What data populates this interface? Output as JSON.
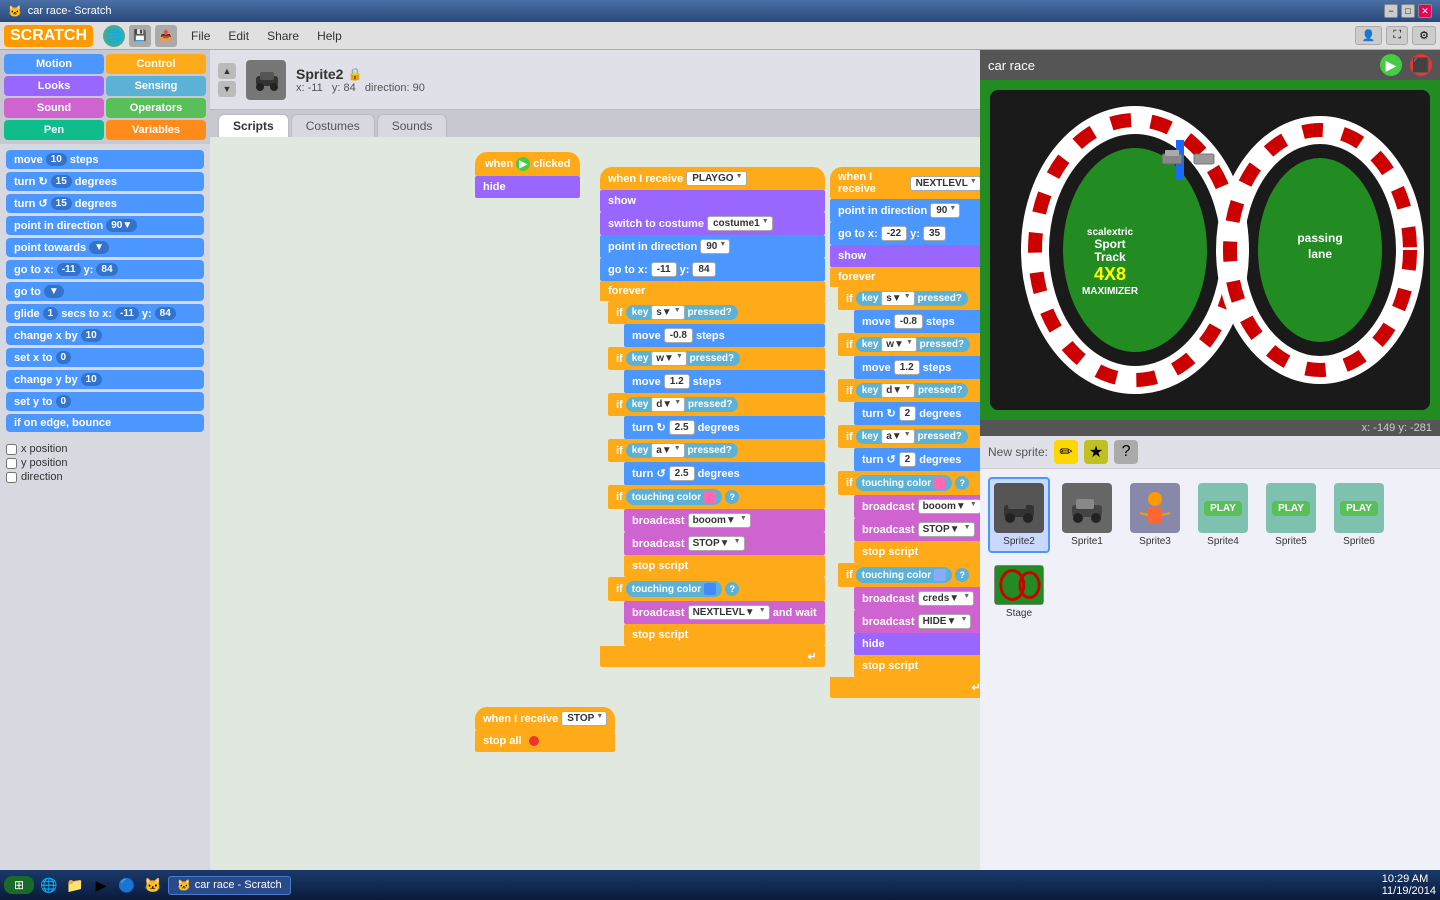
{
  "titlebar": {
    "title": "car race- Scratch",
    "min": "−",
    "max": "□",
    "close": "✕"
  },
  "menubar": {
    "logo": "SCRATCH",
    "items": [
      "File",
      "Edit",
      "Share",
      "Help"
    ],
    "sprite_tools": [
      "⊞",
      "⊟",
      "⊠"
    ]
  },
  "sprite": {
    "name": "Sprite2",
    "x": "-11",
    "y": "84",
    "direction": "90",
    "coords_label": "x:",
    "y_label": "y:",
    "dir_label": "direction:"
  },
  "tabs": [
    "Scripts",
    "Costumes",
    "Sounds"
  ],
  "categories": [
    {
      "label": "Motion",
      "class": "cat-motion"
    },
    {
      "label": "Control",
      "class": "cat-control"
    },
    {
      "label": "Looks",
      "class": "cat-looks"
    },
    {
      "label": "Sensing",
      "class": "cat-sensing"
    },
    {
      "label": "Sound",
      "class": "cat-sound"
    },
    {
      "label": "Operators",
      "class": "cat-operators"
    },
    {
      "label": "Pen",
      "class": "cat-pen"
    },
    {
      "label": "Variables",
      "class": "cat-variables"
    }
  ],
  "blocks": [
    {
      "text": "move",
      "val": "10",
      "suffix": "steps"
    },
    {
      "text": "turn ↻",
      "val": "15",
      "suffix": "degrees"
    },
    {
      "text": "turn ↺",
      "val": "15",
      "suffix": "degrees"
    },
    {
      "text": "point in direction",
      "val": "90▼"
    },
    {
      "text": "point towards",
      "val": "▼"
    },
    {
      "text": "go to x:",
      "val": "-11",
      "y": "84"
    },
    {
      "text": "go to",
      "val": "▼"
    },
    {
      "text": "glide",
      "val": "1",
      "secs": "secs to x:",
      "xval": "-11",
      "yval": "84"
    },
    {
      "text": "change x by",
      "val": "10"
    },
    {
      "text": "set x to",
      "val": "0"
    },
    {
      "text": "change y by",
      "val": "10"
    },
    {
      "text": "set y to",
      "val": "0"
    },
    {
      "text": "if on edge, bounce"
    }
  ],
  "checkboxes": [
    {
      "label": "x position"
    },
    {
      "label": "y position"
    },
    {
      "label": "direction"
    }
  ],
  "scripts": {
    "script1": {
      "hat": "when 🏁 clicked",
      "blocks": [
        {
          "type": "hat",
          "text": "when 🏁 clicked"
        },
        {
          "type": "block",
          "color": "purple",
          "text": "hide"
        }
      ]
    },
    "script2": {
      "hat": "when I receive PLAYGO",
      "blocks": [
        "show",
        "switch to costume costume1▼",
        "point in direction 90▼",
        "go to x: -11 y: 84",
        "forever",
        "if key s▼ pressed?",
        "move -0.8 steps",
        "if key w▼ pressed?",
        "move 1.2 steps",
        "if key d▼ pressed?",
        "turn ↻ 2.5 degrees",
        "if key a▼ pressed?",
        "turn ↺ 2.5 degrees",
        "if touching color ?",
        "broadcast booom▼",
        "broadcast STOP▼",
        "stop script",
        "if touching color ?",
        "broadcast NEXTLEVL▼ and wait",
        "stop script"
      ]
    },
    "script3": {
      "hat": "when I receive NEXTLEVL",
      "blocks": [
        "point in direction 90▼",
        "go to x: -22 y: 35",
        "show",
        "forever",
        "if key s▼ pressed?",
        "move -0.8 steps",
        "if key w▼ pressed?",
        "move 1.2 steps",
        "if key d▼ pressed?",
        "turn ↻ 2 degrees",
        "if key a▼ pressed?",
        "turn ↺ 2 degrees",
        "if touching color ?",
        "broadcast booom▼",
        "broadcast STOP▼",
        "stop script",
        "if touching color ?",
        "broadcast creds▼",
        "broadcast HIDE▼",
        "hide",
        "stop script"
      ]
    },
    "script4": {
      "hat": "when I receive STOP",
      "blocks": [
        "stop all 🔴"
      ]
    }
  },
  "stage": {
    "title": "car race",
    "coords": "x: -149  y: -281"
  },
  "sprites": [
    {
      "label": "Sprite2",
      "selected": true,
      "type": "car"
    },
    {
      "label": "Sprite1",
      "type": "car2"
    },
    {
      "label": "Sprite3",
      "type": "person"
    },
    {
      "label": "Sprite4",
      "type": "play"
    },
    {
      "label": "Sprite5",
      "type": "play"
    },
    {
      "label": "Sprite6",
      "type": "play"
    }
  ],
  "taskbar": {
    "time": "10:29 AM",
    "date": "11/19/2014"
  }
}
